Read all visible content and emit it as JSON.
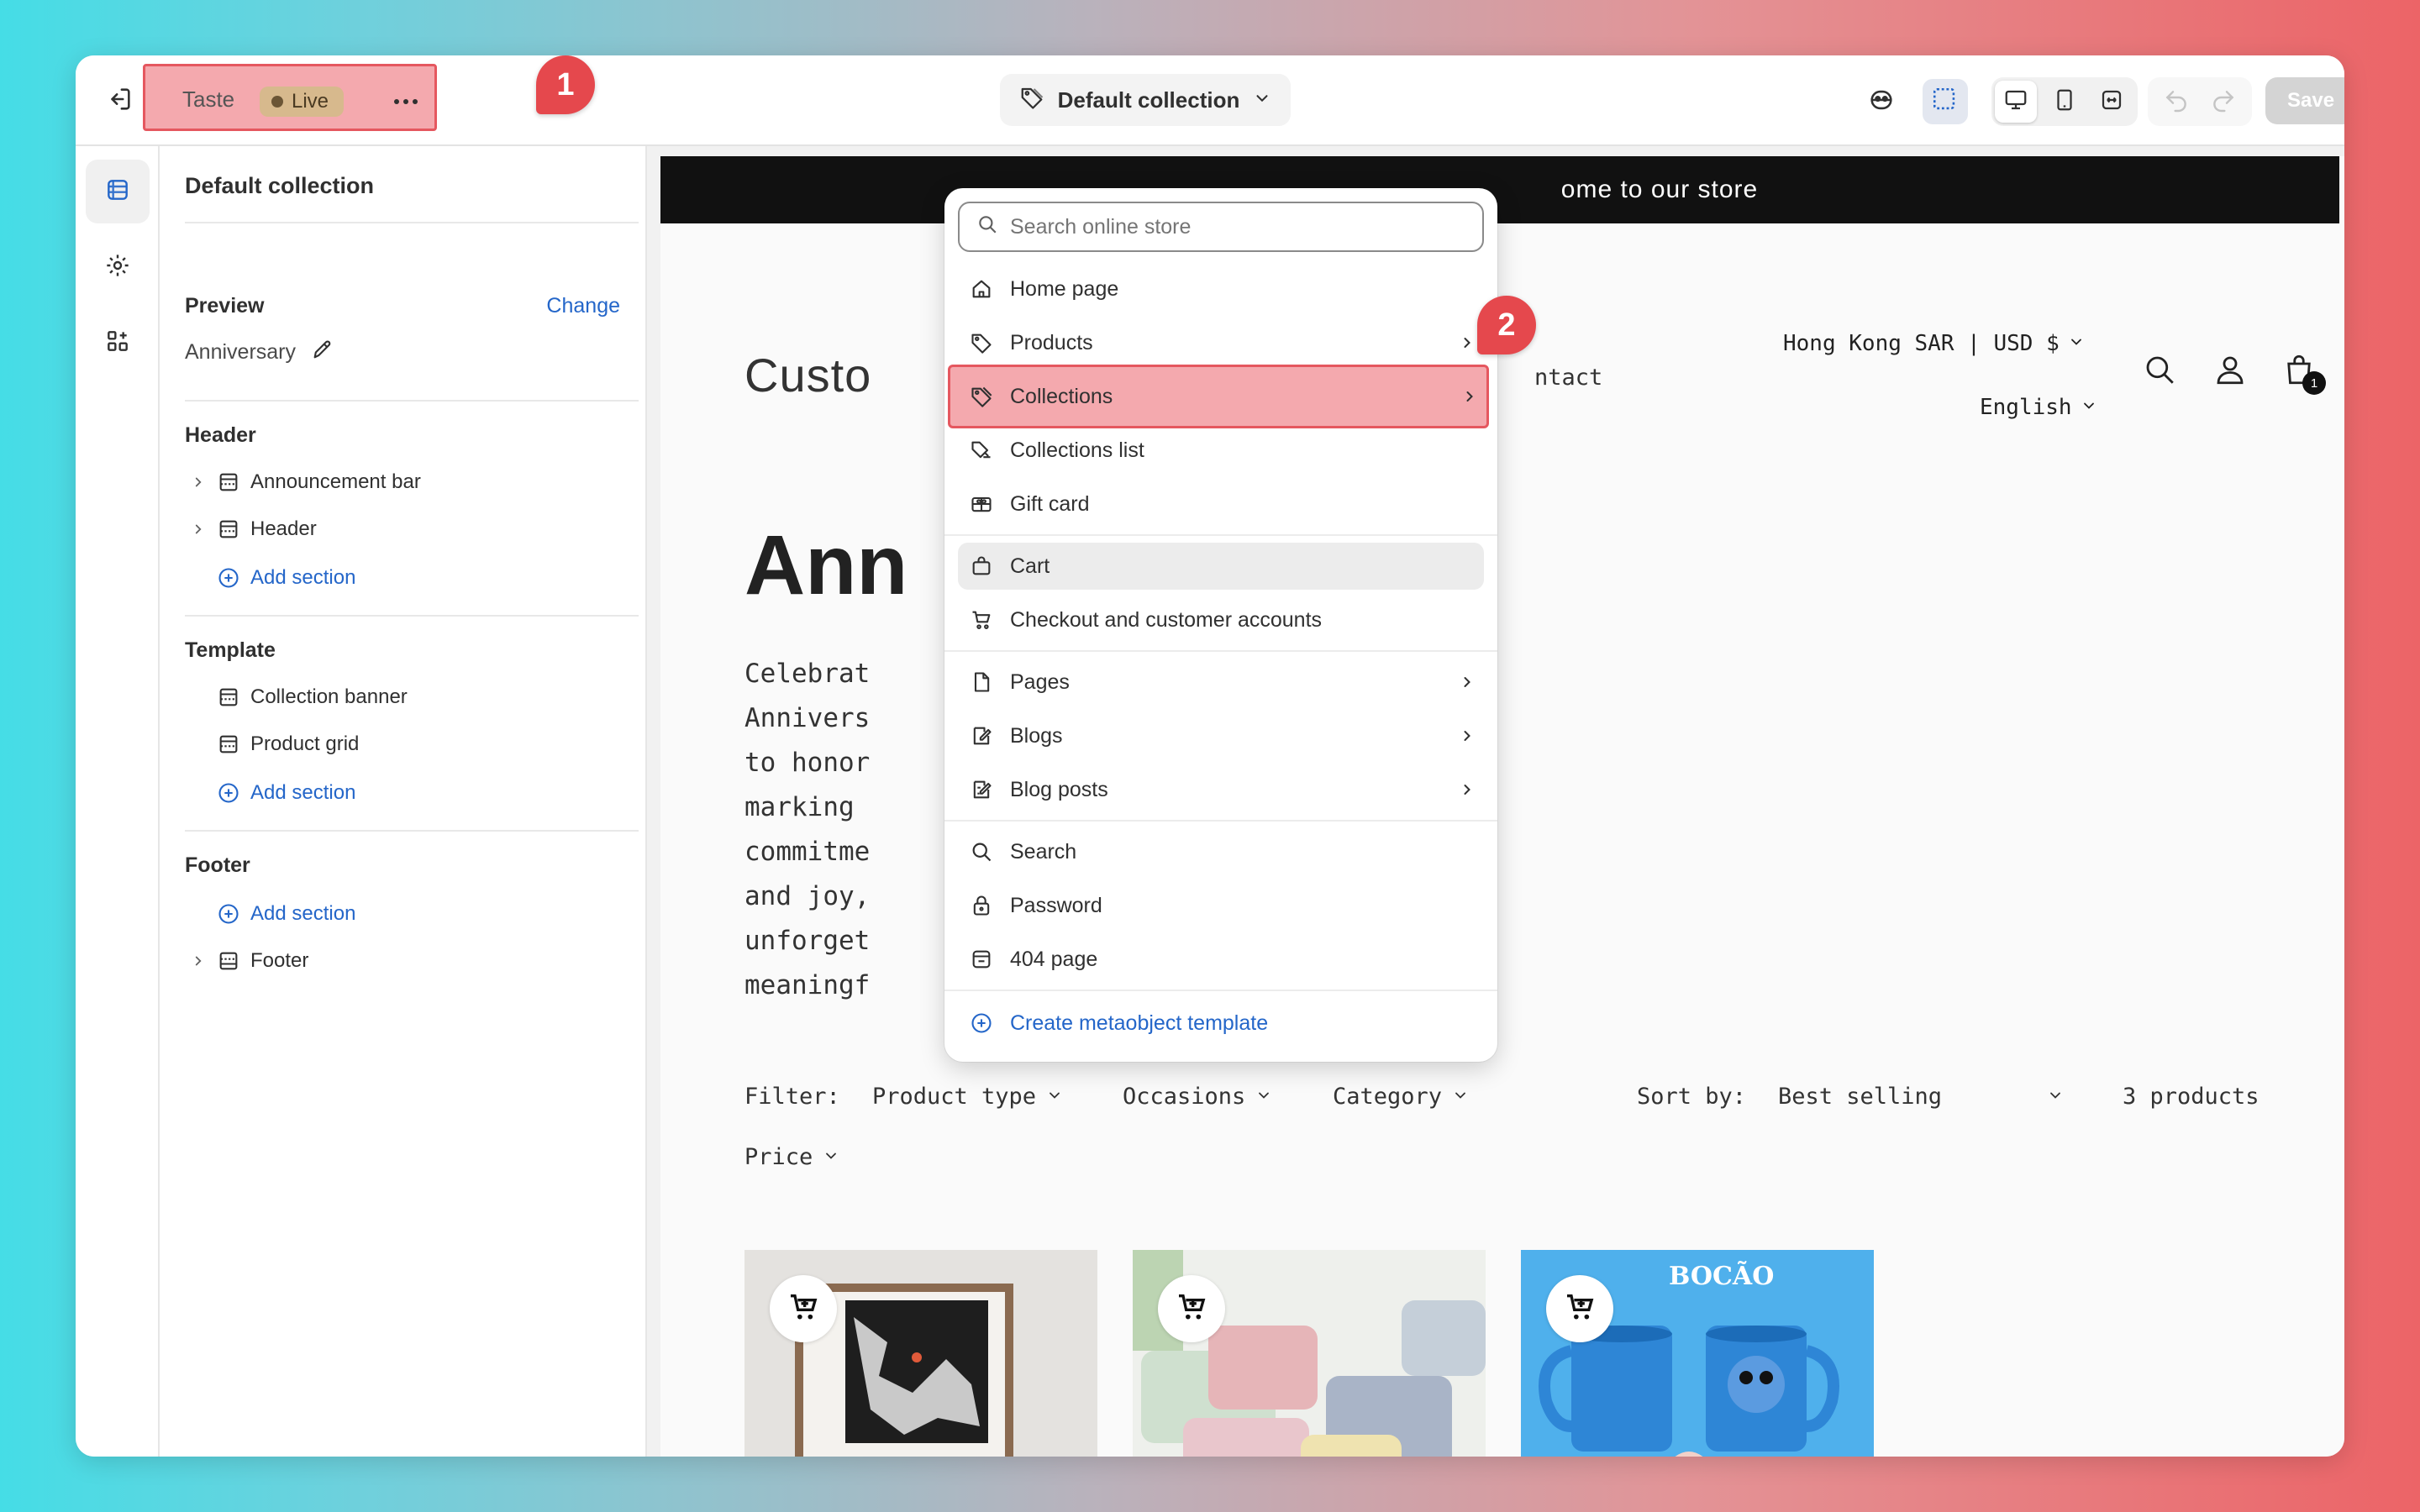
{
  "topbar": {
    "theme_name": "Taste",
    "live_badge": "Live",
    "marker_1": "1",
    "collection_selector": "Default collection",
    "save_label": "Save"
  },
  "sidebar": {
    "title": "Default collection",
    "preview_heading": "Preview",
    "change_label": "Change",
    "preview_value": "Anniversary",
    "header_heading": "Header",
    "header_items": [
      "Announcement bar",
      "Header"
    ],
    "add_section": "Add section",
    "template_heading": "Template",
    "template_items": [
      "Collection banner",
      "Product grid"
    ],
    "footer_heading": "Footer",
    "footer_items": [
      "Footer"
    ]
  },
  "dropdown": {
    "search_placeholder": "Search online store",
    "items": [
      {
        "label": "Home page",
        "icon": "home-icon"
      },
      {
        "label": "Products",
        "icon": "tag-icon"
      },
      {
        "label": "Collections",
        "icon": "collection-icon"
      },
      {
        "label": "Collections list",
        "icon": "collections-list-icon"
      },
      {
        "label": "Gift card",
        "icon": "gift-card-icon"
      },
      {
        "label": "Cart",
        "icon": "bag-icon"
      },
      {
        "label": "Checkout and customer accounts",
        "icon": "cart-icon"
      },
      {
        "label": "Pages",
        "icon": "page-icon"
      },
      {
        "label": "Blogs",
        "icon": "blog-icon"
      },
      {
        "label": "Blog posts",
        "icon": "blog-post-icon"
      },
      {
        "label": "Search",
        "icon": "search-icon"
      },
      {
        "label": "Password",
        "icon": "lock-icon"
      },
      {
        "label": "404 page",
        "icon": "error-page-icon"
      },
      {
        "label": "Create metaobject template",
        "icon": "plus-circle-icon"
      }
    ],
    "marker_2": "2"
  },
  "preview": {
    "announcement": "ome to our store",
    "store_logo": "Custo",
    "nav_contact": "ntact",
    "region": "Hong Kong SAR | USD $",
    "language": "English",
    "cart_count": "1",
    "collection_title": "Ann",
    "description_lines": [
      "Celebrat                     mories with our",
      "Annivers                     oughtfully chosen",
      "to honor                     ether you’re",
      "marking                      ifetime of",
      "commitme                      love, gratitude,",
      "and joy,                     y anniversary",
      "unforget                      even more",
      "meaningf"
    ],
    "filter_label": "Filter:",
    "filters": [
      "Product type",
      "Occasions",
      "Category",
      "Price"
    ],
    "sort_label": "Sort by:",
    "sort_value": "Best selling",
    "product_count": "3 products",
    "product_3_caption": "BOCÃO"
  },
  "colors": {
    "accent_blue": "#2466c9",
    "annotation_red": "#e5484d",
    "highlight_fill": "#f4a9ae"
  }
}
